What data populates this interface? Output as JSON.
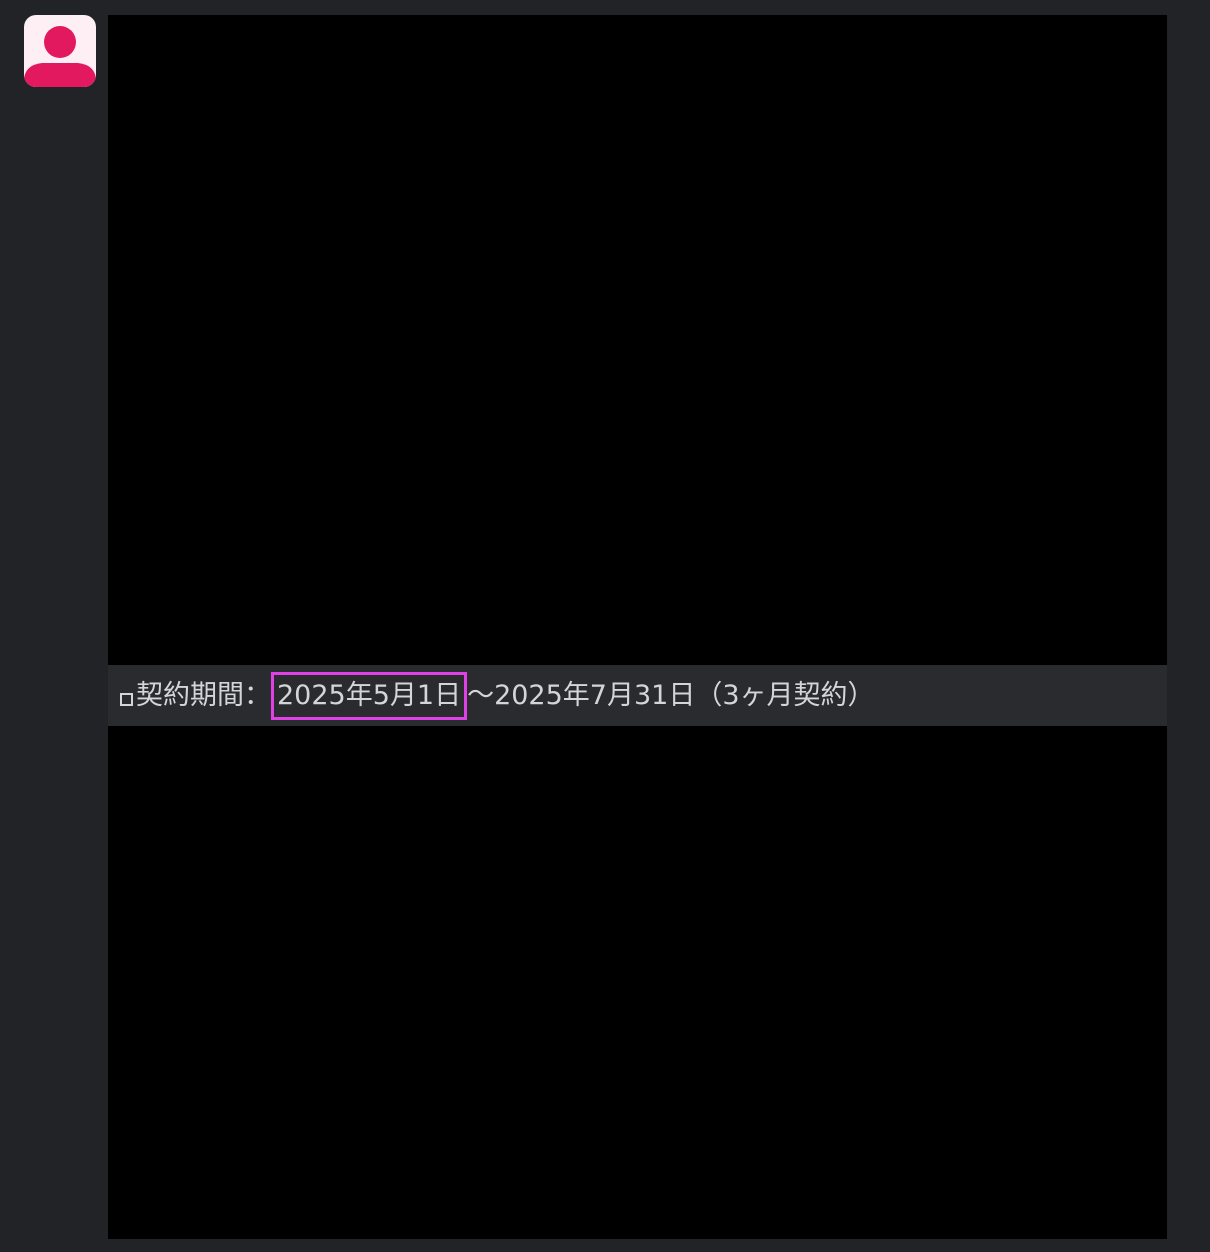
{
  "avatar": {
    "icon": "user-icon",
    "fg_color": "#e3195f",
    "bg_color": "#fdeff3"
  },
  "message": {
    "label": "契約期間：",
    "start_date": "2025年5月1日",
    "rest": "〜2025年7月31日（3ヶ月契約）",
    "highlight_color": "#e040e6"
  }
}
